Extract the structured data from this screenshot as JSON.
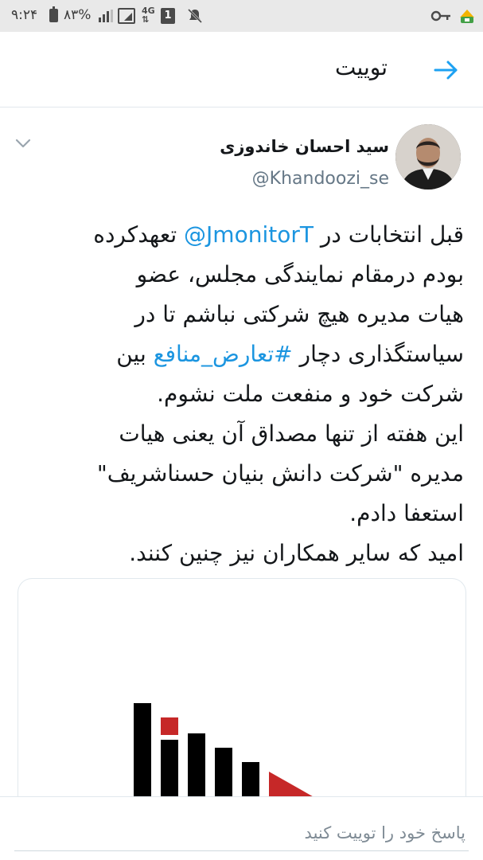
{
  "status_bar": {
    "time": "۹:۲۴",
    "battery": "۸۳%",
    "network": "4G",
    "sim": "1"
  },
  "header": {
    "title": "توییت"
  },
  "tweet": {
    "author_name": "سید احسان خاندوزی",
    "author_handle": "@Khandoozi_se",
    "text": {
      "l1_before": "قبل انتخابات در ",
      "l1_mention": "@JmonitorT",
      "l1_after": " تعهدکرده",
      "l2": "بودم درمقام نمایندگی مجلس، عضو",
      "l3": "هیات مدیره هیچ شرکتی نباشم تا در",
      "l4_before": "سیاستگذاری دچار ",
      "l4_hashtag": "#تعارض_منافع",
      "l4_after": " بین",
      "l5": "شرکت خود و منفعت ملت نشوم.",
      "l6": "این هفته از تنها مصداق آن یعنی هیات",
      "l7": "مدیره \"شرکت دانش بنیان حسناشریف\"",
      "l8": "استعفا دادم.",
      "l9": "امید که سایر همکاران نیز چنین کنند."
    },
    "card": {
      "logo_icon": "bar-chart-logo-icon",
      "colors": {
        "bars": "#000000",
        "accent": "#c62828"
      }
    }
  },
  "reply": {
    "placeholder": "پاسخ خود را توییت کنید"
  },
  "colors": {
    "link": "#1b95e0",
    "back_arrow": "#1da1f2",
    "statusbar_bg": "#e9e9e9"
  }
}
